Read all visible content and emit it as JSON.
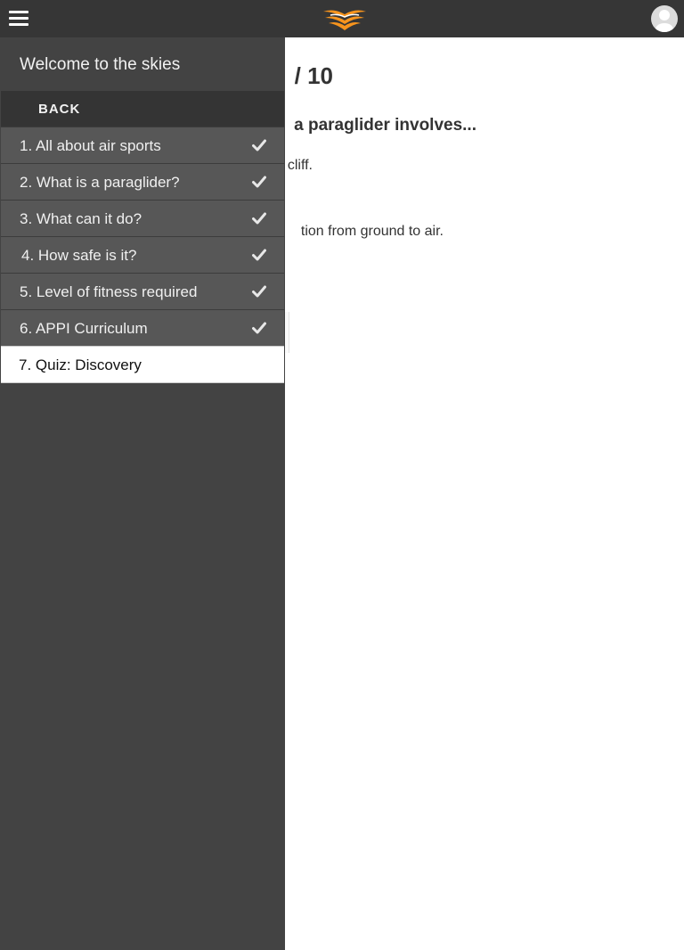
{
  "topbar": {
    "menu_icon": "hamburger-menu-icon",
    "logo_icon": "wing-logo-icon",
    "avatar_icon": "user-avatar-icon",
    "logo_colors": [
      "#f7941d",
      "#ffffff"
    ]
  },
  "main": {
    "score": "/ 10",
    "question": "a paraglider involves...",
    "answers": [
      "cliff.",
      "tion from ground to air."
    ]
  },
  "drawer": {
    "title": "Welcome to the skies",
    "back_label": "BACK",
    "items": [
      {
        "label": "1. All about air sports",
        "completed": true
      },
      {
        "label": "2. What is a paraglider?",
        "completed": true
      },
      {
        "label": "3. What can it do?",
        "completed": true
      },
      {
        "label": "4. How safe is it?",
        "completed": true
      },
      {
        "label": "5. Level of fitness required",
        "completed": true
      },
      {
        "label": "6. APPI Curriculum",
        "completed": true
      },
      {
        "label": "7. Quiz: Discovery",
        "completed": false,
        "active": true
      }
    ],
    "check_icon": "checkmark-icon",
    "colors": {
      "drawer_bg": "#434343",
      "item_bg": "#575757",
      "active_bg": "#ffffff",
      "topbar_bg": "#363636"
    }
  }
}
